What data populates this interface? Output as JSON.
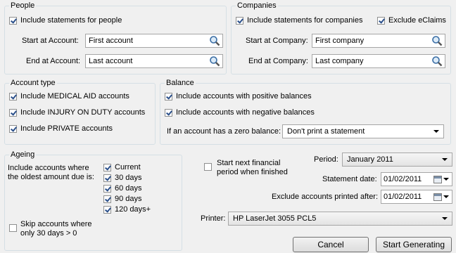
{
  "people": {
    "title": "People",
    "include_label": "Include statements for people",
    "include_checked": true,
    "start_label": "Start at Account:",
    "start_value": "First account",
    "end_label": "End at Account:",
    "end_value": "Last account"
  },
  "companies": {
    "title": "Companies",
    "include_label": "Include statements for companies",
    "include_checked": true,
    "exclude_label": "Exclude eClaims",
    "exclude_checked": true,
    "start_label": "Start at Company:",
    "start_value": "First company",
    "end_label": "End at Company:",
    "end_value": "Last company"
  },
  "account_type": {
    "title": "Account type",
    "items": [
      {
        "label": "Include MEDICAL AID accounts",
        "checked": true
      },
      {
        "label": "Include INJURY ON DUTY accounts",
        "checked": true
      },
      {
        "label": "Include PRIVATE accounts",
        "checked": true
      }
    ]
  },
  "balance": {
    "title": "Balance",
    "positive_label": "Include accounts with positive balances",
    "positive_checked": true,
    "negative_label": "Include accounts with negative balances",
    "negative_checked": true,
    "zero_label": "If an account has a zero balance:",
    "zero_value": "Don't print a statement"
  },
  "ageing": {
    "title": "Ageing",
    "description_line1": "Include accounts where",
    "description_line2": "the oldest amount due is:",
    "items": [
      {
        "label": "Current",
        "checked": true
      },
      {
        "label": "30 days",
        "checked": true
      },
      {
        "label": "60 days",
        "checked": true
      },
      {
        "label": "90 days",
        "checked": true
      },
      {
        "label": "120 days+",
        "checked": true
      }
    ],
    "skip_line1": "Skip accounts where",
    "skip_line2": "only 30 days > 0",
    "skip_checked": false
  },
  "options": {
    "next_period_line1": "Start next financial",
    "next_period_line2": "period when finished",
    "next_period_checked": false,
    "period_label": "Period:",
    "period_value": "January 2011",
    "statement_date_label": "Statement date:",
    "statement_date_value": "01/02/2011",
    "exclude_after_label": "Exclude accounts printed after:",
    "exclude_after_value": "01/02/2011",
    "printer_label": "Printer:",
    "printer_value": "HP LaserJet 3055 PCL5"
  },
  "buttons": {
    "cancel": "Cancel",
    "start": "Start Generating"
  }
}
